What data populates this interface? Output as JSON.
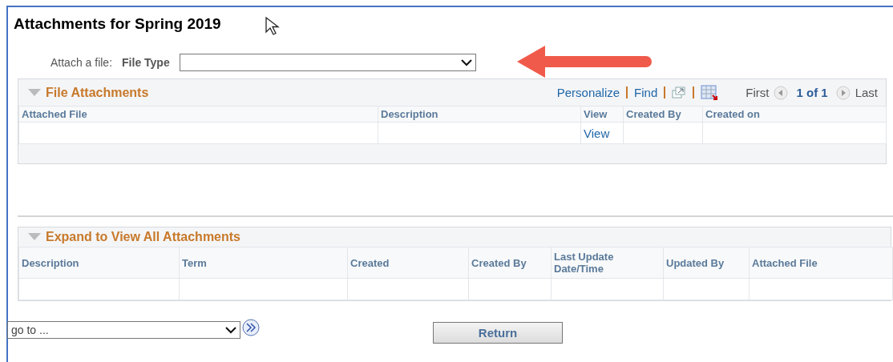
{
  "page": {
    "title": "Attachments for Spring 2019"
  },
  "attach": {
    "label": "Attach a file:",
    "field_label": "File Type"
  },
  "file_attachments": {
    "title": "File Attachments",
    "expanded": true,
    "toolbar": {
      "personalize": "Personalize",
      "find": "Find",
      "first": "First",
      "count": "1 of 1",
      "last": "Last"
    },
    "columns": [
      "Attached File",
      "Description",
      "View",
      "Created By",
      "Created on"
    ],
    "rows": [
      [
        "",
        "",
        "View",
        "",
        ""
      ]
    ]
  },
  "all_attachments": {
    "title": "Expand to View All Attachments",
    "expanded": true,
    "columns": [
      "Description",
      "Term",
      "Created",
      "Created By",
      "Last Update Date/Time",
      "Updated By",
      "Attached File"
    ],
    "rows": [
      [
        "",
        "",
        "",
        "",
        "",
        "",
        ""
      ]
    ]
  },
  "goto": {
    "placeholder": "go to ..."
  },
  "return_button": "Return"
}
